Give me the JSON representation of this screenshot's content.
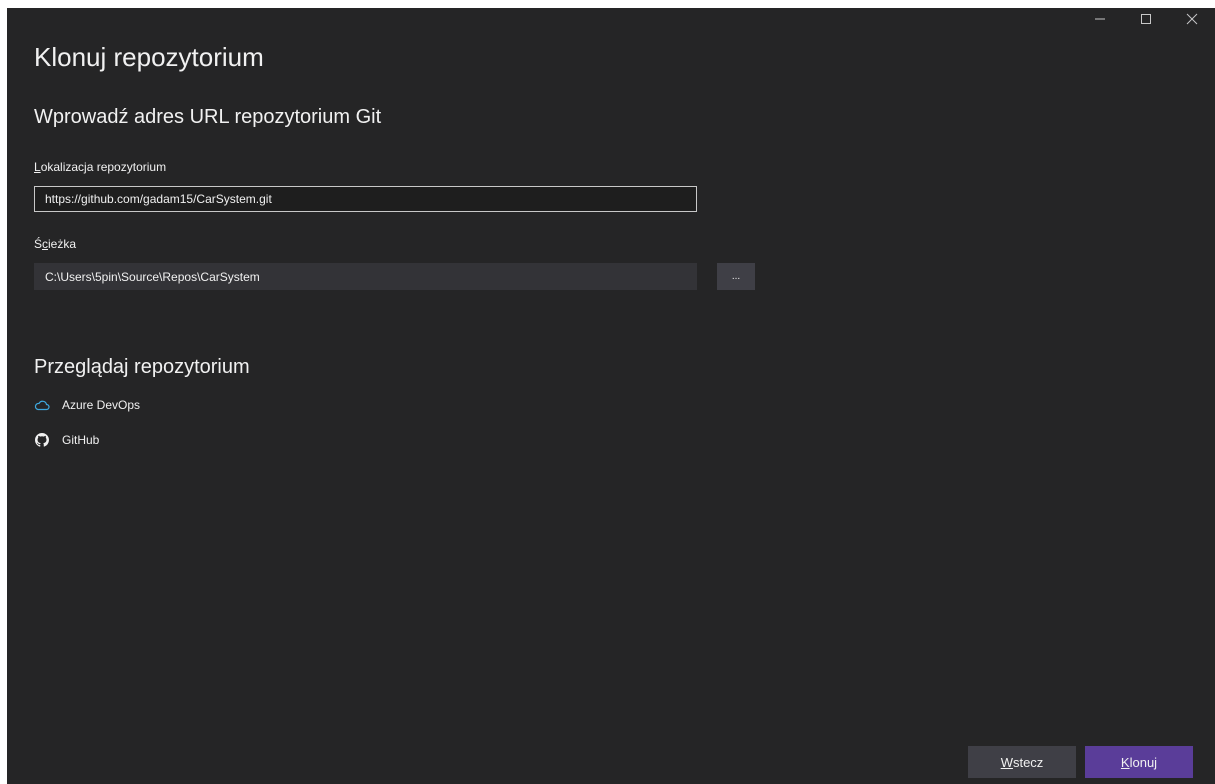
{
  "window_controls": {
    "minimize_icon": "minimize-icon",
    "maximize_icon": "maximize-icon",
    "close_icon": "close-icon"
  },
  "title": "Klonuj repozytorium",
  "url_section": {
    "heading": "Wprowadź adres URL repozytorium Git",
    "location_label_access": "L",
    "location_label_rest": "okalizacja repozytorium",
    "location_value": "https://github.com/gadam15/CarSystem.git",
    "path_label_first": "Ś",
    "path_label_access": "c",
    "path_label_rest": "ieżka",
    "path_value": "C:\\Users\\5pin\\Source\\Repos\\CarSystem",
    "browse_label": "..."
  },
  "browse_section": {
    "heading": "Przeglądaj repozytorium",
    "items": [
      {
        "label": "Azure DevOps",
        "icon": "cloud-icon"
      },
      {
        "label": "GitHub",
        "icon": "github-icon"
      }
    ]
  },
  "footer": {
    "back_access": "W",
    "back_rest": "stecz",
    "clone_access": "K",
    "clone_rest": "lonuj"
  },
  "colors": {
    "background": "#252526",
    "accent": "#5a3d99",
    "cloud_icon": "#3ea8de"
  }
}
